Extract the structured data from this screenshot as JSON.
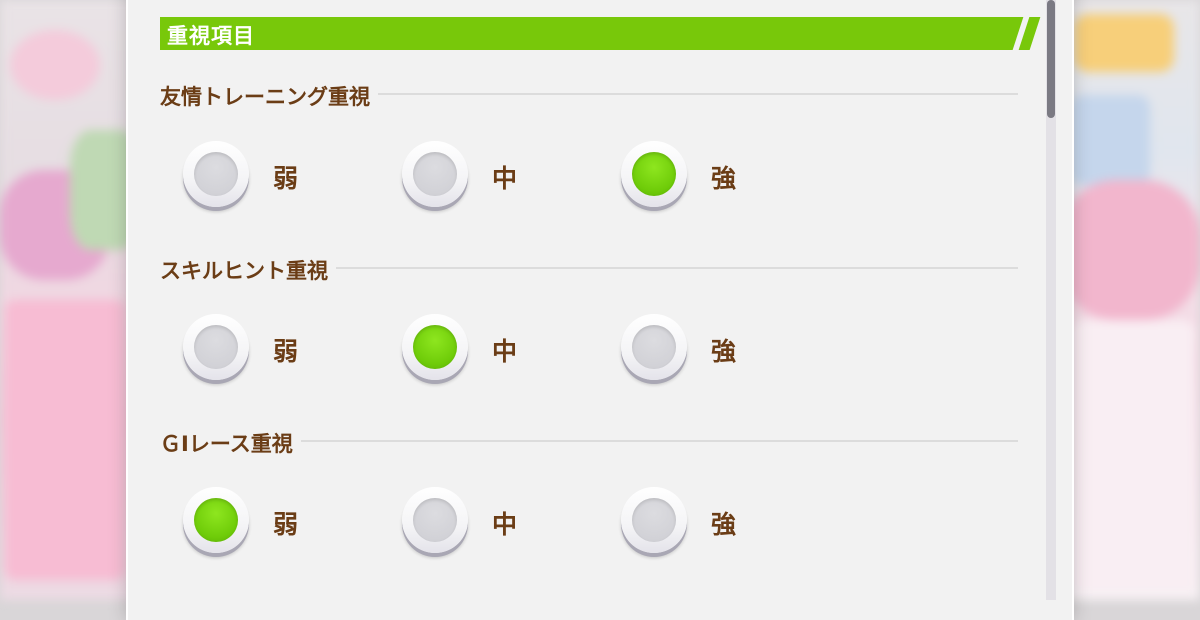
{
  "section": {
    "title": "重視項目",
    "accent_color": "#78c80a"
  },
  "groups": [
    {
      "label": "友情トレーニング重視",
      "options": [
        "弱",
        "中",
        "強"
      ],
      "selected": "強"
    },
    {
      "label": "スキルヒント重視",
      "options": [
        "弱",
        "中",
        "強"
      ],
      "selected": "中"
    },
    {
      "label": "ＧⅠレース重視",
      "options": [
        "弱",
        "中",
        "強"
      ],
      "selected": "弱"
    }
  ],
  "colors": {
    "label_brown": "#6b3d16",
    "selected_green": "#78c80a",
    "panel_bg": "#f2f2f2"
  }
}
